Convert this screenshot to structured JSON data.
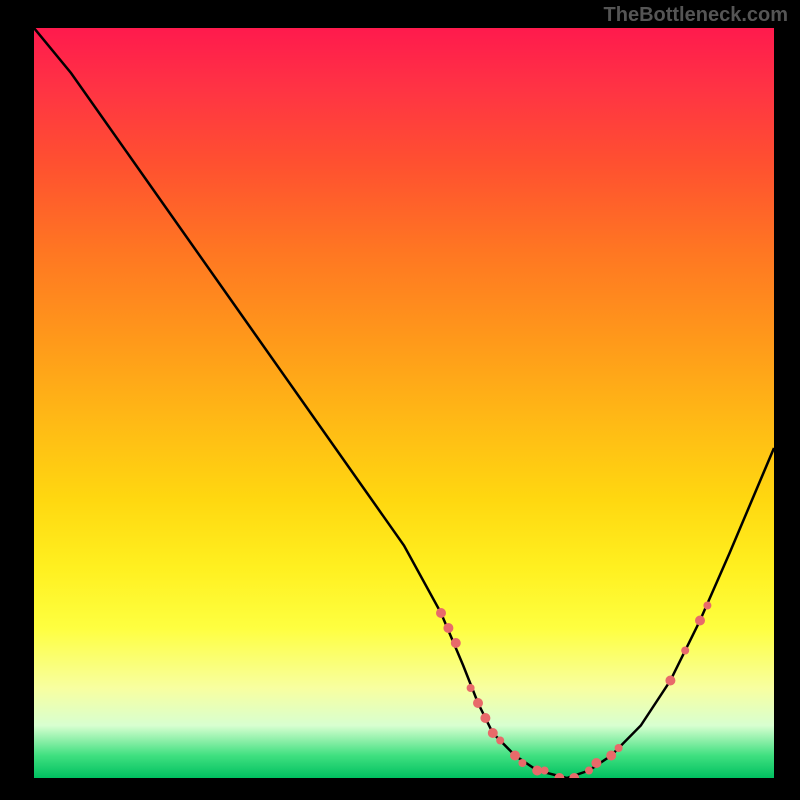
{
  "watermark": "TheBottleneck.com",
  "chart_data": {
    "type": "line",
    "title": "",
    "xlabel": "",
    "ylabel": "",
    "xlim": [
      0,
      100
    ],
    "ylim": [
      0,
      100
    ],
    "curve": {
      "x": [
        0,
        5,
        10,
        15,
        20,
        25,
        30,
        35,
        40,
        45,
        50,
        55,
        58,
        60,
        62,
        65,
        68,
        72,
        75,
        78,
        82,
        86,
        90,
        94,
        100
      ],
      "y": [
        100,
        94,
        87,
        80,
        73,
        66,
        59,
        52,
        45,
        38,
        31,
        22,
        15,
        10,
        6,
        3,
        1,
        0,
        1,
        3,
        7,
        13,
        21,
        30,
        44
      ]
    },
    "markers": [
      {
        "x": 55,
        "y": 22,
        "r": 5
      },
      {
        "x": 56,
        "y": 20,
        "r": 5
      },
      {
        "x": 57,
        "y": 18,
        "r": 5
      },
      {
        "x": 59,
        "y": 12,
        "r": 4
      },
      {
        "x": 60,
        "y": 10,
        "r": 5
      },
      {
        "x": 61,
        "y": 8,
        "r": 5
      },
      {
        "x": 62,
        "y": 6,
        "r": 5
      },
      {
        "x": 63,
        "y": 5,
        "r": 4
      },
      {
        "x": 65,
        "y": 3,
        "r": 5
      },
      {
        "x": 66,
        "y": 2,
        "r": 4
      },
      {
        "x": 68,
        "y": 1,
        "r": 5
      },
      {
        "x": 69,
        "y": 1,
        "r": 4
      },
      {
        "x": 71,
        "y": 0,
        "r": 5
      },
      {
        "x": 73,
        "y": 0,
        "r": 5
      },
      {
        "x": 75,
        "y": 1,
        "r": 4
      },
      {
        "x": 76,
        "y": 2,
        "r": 5
      },
      {
        "x": 78,
        "y": 3,
        "r": 5
      },
      {
        "x": 79,
        "y": 4,
        "r": 4
      },
      {
        "x": 86,
        "y": 13,
        "r": 5
      },
      {
        "x": 88,
        "y": 17,
        "r": 4
      },
      {
        "x": 90,
        "y": 21,
        "r": 5
      },
      {
        "x": 91,
        "y": 23,
        "r": 4
      }
    ],
    "marker_color": "#e86a6a",
    "colors": {
      "gradient_top": "#ff1a4d",
      "gradient_bottom": "#00c060",
      "curve": "#000000"
    }
  }
}
